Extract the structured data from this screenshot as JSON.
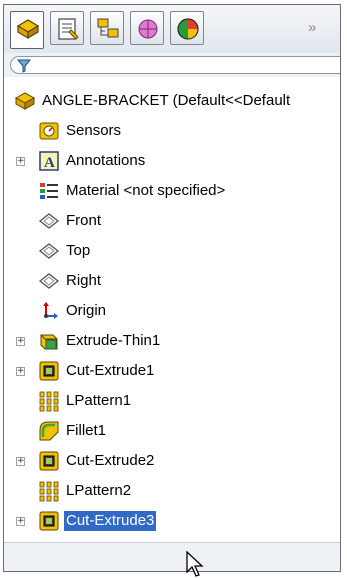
{
  "tabs": [
    {
      "icon": "feature-manager-icon",
      "active": true
    },
    {
      "icon": "property-manager-icon"
    },
    {
      "icon": "configuration-manager-icon"
    },
    {
      "icon": "dimxpert-manager-icon"
    },
    {
      "icon": "display-manager-icon"
    }
  ],
  "tabs_more": "»",
  "filter": {
    "icon": "filter-icon"
  },
  "tree": {
    "root": {
      "label": "ANGLE-BRACKET  (Default<<Default",
      "icon": "part-icon"
    },
    "items": [
      {
        "label": "Sensors",
        "icon": "sensors-icon",
        "expandable": false
      },
      {
        "label": "Annotations",
        "icon": "annotations-icon",
        "expandable": true
      },
      {
        "label": "Material <not specified>",
        "icon": "material-icon",
        "expandable": false
      },
      {
        "label": "Front",
        "icon": "plane-icon",
        "expandable": false
      },
      {
        "label": "Top",
        "icon": "plane-icon",
        "expandable": false
      },
      {
        "label": "Right",
        "icon": "plane-icon",
        "expandable": false
      },
      {
        "label": "Origin",
        "icon": "origin-icon",
        "expandable": false
      },
      {
        "label": "Extrude-Thin1",
        "icon": "extrude-thin-icon",
        "expandable": true
      },
      {
        "label": "Cut-Extrude1",
        "icon": "cut-extrude-icon",
        "expandable": true
      },
      {
        "label": "LPattern1",
        "icon": "linear-pattern-icon",
        "expandable": false
      },
      {
        "label": "Fillet1",
        "icon": "fillet-icon",
        "expandable": false
      },
      {
        "label": "Cut-Extrude2",
        "icon": "cut-extrude-icon",
        "expandable": true
      },
      {
        "label": "LPattern2",
        "icon": "linear-pattern-icon",
        "expandable": false
      },
      {
        "label": "Cut-Extrude3",
        "icon": "cut-extrude-icon",
        "expandable": true,
        "selected": true
      }
    ]
  },
  "colors": {
    "selection": "#3169c6",
    "icon_yellow": "#f2c200",
    "icon_green": "#3aa34a"
  }
}
